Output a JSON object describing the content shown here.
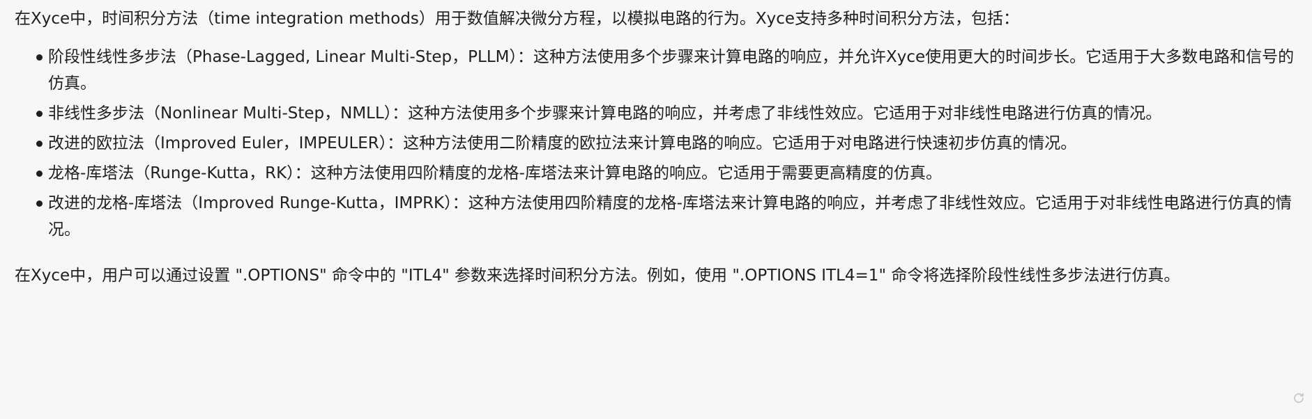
{
  "message": {
    "intro": "在Xyce中，时间积分方法（time integration methods）用于数值解决微分方程，以模拟电路的行为。Xyce支持多种时间积分方法，包括：",
    "items": [
      "阶段性线性多步法（Phase-Lagged, Linear Multi-Step，PLLM）：这种方法使用多个步骤来计算电路的响应，并允许Xyce使用更大的时间步长。它适用于大多数电路和信号的仿真。",
      "非线性多步法（Nonlinear Multi-Step，NMLL）：这种方法使用多个步骤来计算电路的响应，并考虑了非线性效应。它适用于对非线性电路进行仿真的情况。",
      "改进的欧拉法（Improved Euler，IMPEULER）：这种方法使用二阶精度的欧拉法来计算电路的响应。它适用于对电路进行快速初步仿真的情况。",
      "龙格-库塔法（Runge-Kutta，RK）：这种方法使用四阶精度的龙格-库塔法来计算电路的响应。它适用于需要更高精度的仿真。",
      "改进的龙格-库塔法（Improved Runge-Kutta，IMPRK）：这种方法使用四阶精度的龙格-库塔法来计算电路的响应，并考虑了非线性效应。它适用于对非线性电路进行仿真的情况。"
    ],
    "outro": "在Xyce中，用户可以通过设置 \".OPTIONS\" 命令中的 \"ITL4\" 参数来选择时间积分方法。例如，使用 \".OPTIONS ITL4=1\" 命令将选择阶段性线性多步法进行仿真。"
  },
  "icons": {
    "regenerate": "refresh-icon"
  },
  "colors": {
    "text": "#1f1f1f",
    "background": "#f7f7f8",
    "icon": "#c8c8cc"
  }
}
